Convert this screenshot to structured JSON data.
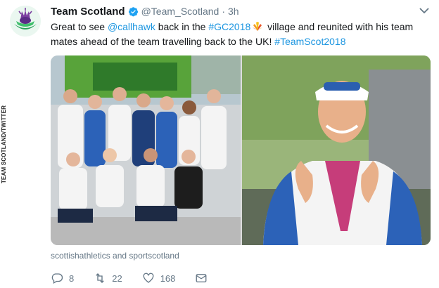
{
  "credit": "TEAM SCOTLAND/TWITTER",
  "tweet": {
    "display_name": "Team Scotland",
    "handle": "@Team_Scotland",
    "separator": "·",
    "time": "3h",
    "text_parts": {
      "p1": "Great to see ",
      "mention": "@callhawk",
      "p2": " back in the ",
      "hashtag1": "#GC2018",
      "p3": " village and reunited with his team mates ahead of the team travelling back to the UK! ",
      "hashtag2": "#TeamScot2018"
    },
    "media_caption": "scottishathletics and sportscotland",
    "actions": {
      "reply_count": "8",
      "retweet_count": "22",
      "like_count": "168"
    }
  },
  "colors": {
    "link": "#1b95e0",
    "verified": "#1da1f2",
    "muted": "#657786"
  },
  "icons": [
    "thistle-logo-icon",
    "verified-badge-icon",
    "chevron-down-icon",
    "gc2018-emoji-icon",
    "reply-icon",
    "retweet-icon",
    "like-icon",
    "message-icon"
  ]
}
